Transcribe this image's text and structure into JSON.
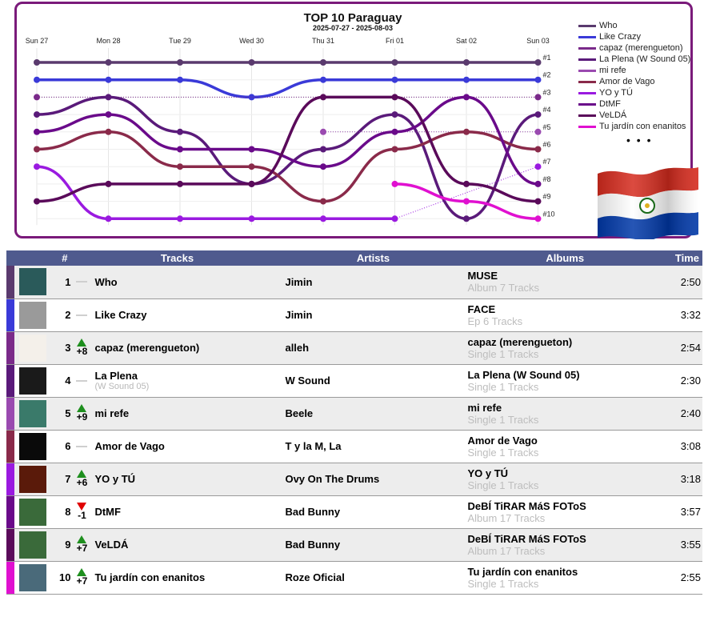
{
  "chart": {
    "title": "TOP 10 Paraguay",
    "subtitle": "2025-07-27 - 2025-08-03",
    "days": [
      "Sun 27",
      "Mon 28",
      "Tue 29",
      "Wed 30",
      "Thu 31",
      "Fri 01",
      "Sat 02",
      "Sun 03"
    ],
    "rank_labels": [
      "#1",
      "#2",
      "#3",
      "#4",
      "#5",
      "#6",
      "#7",
      "#8",
      "#9",
      "#10"
    ],
    "legend_more": "• • •"
  },
  "chart_data": {
    "type": "line",
    "title": "TOP 10 Paraguay",
    "subtitle": "2025-07-27 - 2025-08-03",
    "x": [
      "Sun 27",
      "Mon 28",
      "Tue 29",
      "Wed 30",
      "Thu 31",
      "Fri 01",
      "Sat 02",
      "Sun 03"
    ],
    "y_reversed": true,
    "ylim": [
      1,
      10
    ],
    "legend_position": "right",
    "series": [
      {
        "name": "Who",
        "color": "#5a3a6e",
        "values": [
          1,
          1,
          1,
          1,
          1,
          1,
          1,
          1
        ]
      },
      {
        "name": "Like Crazy",
        "color": "#3a3ad8",
        "values": [
          2,
          2,
          2,
          3,
          2,
          2,
          2,
          2
        ]
      },
      {
        "name": "capaz (merengueton)",
        "color": "#7a2a8a",
        "values": [
          3,
          null,
          null,
          null,
          null,
          null,
          null,
          3
        ]
      },
      {
        "name": "La Plena (W Sound 05)",
        "color": "#5a1a7a",
        "values": [
          4,
          3,
          5,
          8,
          6,
          4,
          10,
          4
        ]
      },
      {
        "name": "mi refe",
        "color": "#9a4ab0",
        "values": [
          null,
          null,
          null,
          null,
          5,
          null,
          null,
          5
        ]
      },
      {
        "name": "Amor de Vago",
        "color": "#8a2a4a",
        "values": [
          6,
          5,
          7,
          7,
          9,
          6,
          5,
          6
        ]
      },
      {
        "name": "YO y TÚ",
        "color": "#9a1ae0",
        "values": [
          7,
          10,
          10,
          10,
          10,
          10,
          null,
          7
        ]
      },
      {
        "name": "DtMF",
        "color": "#6a0a8a",
        "values": [
          5,
          4,
          6,
          6,
          7,
          5,
          3,
          8
        ]
      },
      {
        "name": "VeLDÁ",
        "color": "#5a0a5a",
        "values": [
          9,
          8,
          8,
          8,
          3,
          3,
          8,
          9
        ]
      },
      {
        "name": "Tu jardín con enanitos",
        "color": "#e010d0",
        "values": [
          null,
          null,
          null,
          null,
          null,
          8,
          9,
          10
        ]
      }
    ]
  },
  "legend": [
    {
      "label": "Who",
      "color": "#5a3a6e"
    },
    {
      "label": "Like Crazy",
      "color": "#3a3ad8"
    },
    {
      "label": "capaz (merengueton)",
      "color": "#7a2a8a"
    },
    {
      "label": "La Plena (W Sound 05)",
      "color": "#5a1a7a"
    },
    {
      "label": "mi refe",
      "color": "#9a4ab0"
    },
    {
      "label": "Amor de Vago",
      "color": "#8a2a4a"
    },
    {
      "label": "YO y TÚ",
      "color": "#9a1ae0"
    },
    {
      "label": "DtMF",
      "color": "#6a0a8a"
    },
    {
      "label": "VeLDÁ",
      "color": "#5a0a5a"
    },
    {
      "label": "Tu jardín con enanitos",
      "color": "#e010d0"
    }
  ],
  "table": {
    "headers": {
      "rank": "#",
      "tracks": "Tracks",
      "artists": "Artists",
      "albums": "Albums",
      "time": "Time"
    },
    "rows": [
      {
        "rank": "1",
        "move": "same",
        "move_text": "",
        "track": "Who",
        "track_sub": "",
        "artist": "Jimin",
        "album": "MUSE",
        "album_sub": "Album 7 Tracks",
        "time": "2:50",
        "color": "#5a3a6e",
        "cover": "#2a5a5a"
      },
      {
        "rank": "2",
        "move": "same",
        "move_text": "",
        "track": "Like Crazy",
        "track_sub": "",
        "artist": "Jimin",
        "album": "FACE",
        "album_sub": "Ep 6 Tracks",
        "time": "3:32",
        "color": "#3a3ad8",
        "cover": "#9a9a9a"
      },
      {
        "rank": "3",
        "move": "up",
        "move_text": "+8",
        "track": "capaz (merengueton)",
        "track_sub": "",
        "artist": "alleh",
        "album": "capaz (merengueton)",
        "album_sub": "Single 1 Tracks",
        "time": "2:54",
        "color": "#7a2a8a",
        "cover": "#f4f0ea"
      },
      {
        "rank": "4",
        "move": "same",
        "move_text": "",
        "track": "La Plena",
        "track_sub": "(W Sound 05)",
        "artist": "W Sound",
        "album": "La Plena (W Sound 05)",
        "album_sub": "Single 1 Tracks",
        "time": "2:30",
        "color": "#5a1a7a",
        "cover": "#1a1a1a"
      },
      {
        "rank": "5",
        "move": "up",
        "move_text": "+9",
        "track": "mi refe",
        "track_sub": "",
        "artist": "Beele",
        "album": "mi refe",
        "album_sub": "Single 1 Tracks",
        "time": "2:40",
        "color": "#9a4ab0",
        "cover": "#3a7a6a"
      },
      {
        "rank": "6",
        "move": "same",
        "move_text": "",
        "track": "Amor de Vago",
        "track_sub": "",
        "artist": "T y la M, La",
        "album": "Amor de Vago",
        "album_sub": "Single 1 Tracks",
        "time": "3:08",
        "color": "#8a2a4a",
        "cover": "#0a0a0a"
      },
      {
        "rank": "7",
        "move": "up",
        "move_text": "+6",
        "track": "YO y TÚ",
        "track_sub": "",
        "artist": "Ovy On The Drums",
        "album": "YO y TÚ",
        "album_sub": "Single 1 Tracks",
        "time": "3:18",
        "color": "#9a1ae0",
        "cover": "#5a1a0a"
      },
      {
        "rank": "8",
        "move": "down",
        "move_text": "-1",
        "track": "DtMF",
        "track_sub": "",
        "artist": "Bad Bunny",
        "album": "DeBÍ TiRAR MáS FOToS",
        "album_sub": "Album 17 Tracks",
        "time": "3:57",
        "color": "#6a0a8a",
        "cover": "#3a6a3a"
      },
      {
        "rank": "9",
        "move": "up",
        "move_text": "+7",
        "track": "VeLDÁ",
        "track_sub": "",
        "artist": "Bad Bunny",
        "album": "DeBÍ TiRAR MáS FOToS",
        "album_sub": "Album 17 Tracks",
        "time": "3:55",
        "color": "#5a0a5a",
        "cover": "#3a6a3a"
      },
      {
        "rank": "10",
        "move": "up",
        "move_text": "+7",
        "track": "Tu jardín con enanitos",
        "track_sub": "",
        "artist": "Roze Oficial",
        "album": "Tu jardín con enanitos",
        "album_sub": "Single 1 Tracks",
        "time": "2:55",
        "color": "#e010d0",
        "cover": "#4a6a7a"
      }
    ]
  }
}
